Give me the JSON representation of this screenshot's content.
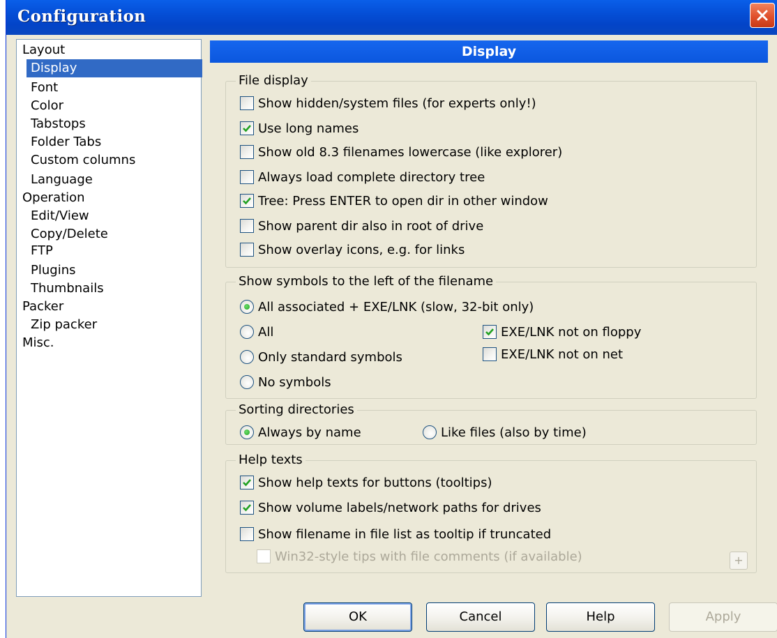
{
  "window": {
    "title": "Configuration"
  },
  "tree": {
    "items": [
      {
        "label": "Layout"
      },
      {
        "label": "Display"
      },
      {
        "label": "Font"
      },
      {
        "label": "Color"
      },
      {
        "label": "Tabstops"
      },
      {
        "label": "Folder Tabs"
      },
      {
        "label": "Custom columns"
      },
      {
        "label": "Language"
      },
      {
        "label": "Operation"
      },
      {
        "label": "Edit/View"
      },
      {
        "label": "Copy/Delete"
      },
      {
        "label": "FTP"
      },
      {
        "label": "Plugins"
      },
      {
        "label": "Thumbnails"
      },
      {
        "label": "Packer"
      },
      {
        "label": "Zip packer"
      },
      {
        "label": "Misc."
      }
    ],
    "selected": "Display"
  },
  "header": {
    "title": "Display"
  },
  "file_display": {
    "legend": "File display",
    "options": [
      {
        "label": "Show hidden/system files (for experts only!)",
        "checked": false
      },
      {
        "label": "Use long names",
        "checked": true
      },
      {
        "label": "Show old 8.3 filenames lowercase (like explorer)",
        "checked": false
      },
      {
        "label": "Always load complete directory tree",
        "checked": false
      },
      {
        "label": "Tree: Press ENTER to open dir in other window",
        "checked": true
      },
      {
        "label": "Show parent dir also in root of drive",
        "checked": false
      },
      {
        "label": "Show overlay icons, e.g. for links",
        "checked": false
      }
    ]
  },
  "symbols": {
    "legend": "Show symbols to the left of the filename",
    "radios": [
      {
        "label": "All associated + EXE/LNK (slow, 32-bit only)",
        "selected": true
      },
      {
        "label": "All",
        "selected": false
      },
      {
        "label": "Only standard symbols",
        "selected": false
      },
      {
        "label": "No symbols",
        "selected": false
      }
    ],
    "checks": [
      {
        "label": "EXE/LNK not on floppy",
        "checked": true
      },
      {
        "label": "EXE/LNK not on net",
        "checked": false
      }
    ]
  },
  "sorting": {
    "legend": "Sorting directories",
    "radios": [
      {
        "label": "Always by name",
        "selected": true
      },
      {
        "label": "Like files (also by time)",
        "selected": false
      }
    ]
  },
  "help_texts": {
    "legend": "Help texts",
    "options": [
      {
        "label": "Show help texts for buttons (tooltips)",
        "checked": true
      },
      {
        "label": "Show volume labels/network paths for drives",
        "checked": true
      },
      {
        "label": "Show filename in file list as tooltip if truncated",
        "checked": false
      },
      {
        "label": "Win32-style tips with file comments (if available)",
        "checked": false,
        "disabled": true
      }
    ],
    "plus_label": "+"
  },
  "buttons": {
    "ok": "OK",
    "cancel": "Cancel",
    "help": "Help",
    "apply": "Apply"
  },
  "colors": {
    "title_bar": "#0550D8",
    "selection": "#316AC5",
    "dialog_bg": "#ECE9D8",
    "check_green": "#21A121",
    "close_red": "#E0502C"
  }
}
